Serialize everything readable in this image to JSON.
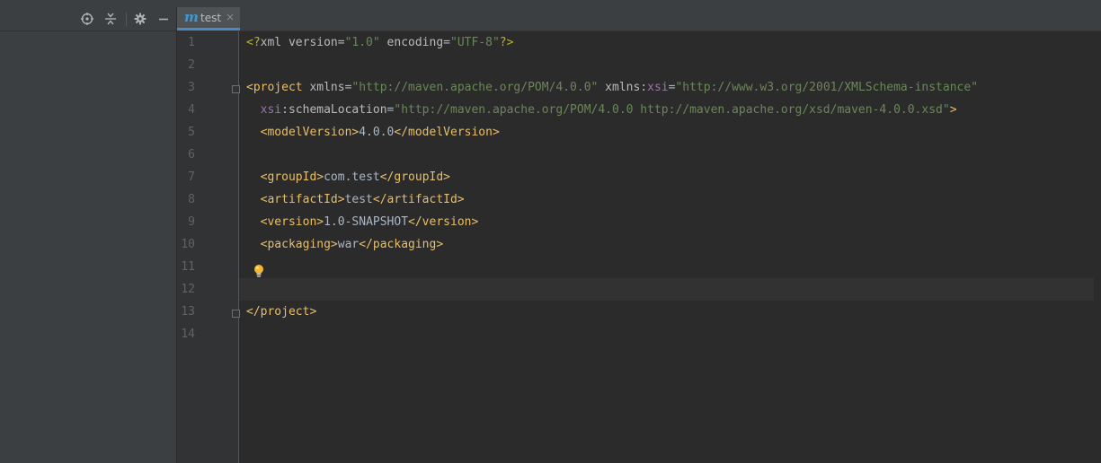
{
  "sidebar": {
    "buttons": [
      {
        "name": "locate-icon",
        "label": "Scroll from Source"
      },
      {
        "name": "collapse-all-icon",
        "label": "Collapse All"
      },
      {
        "name": "gear-icon",
        "label": "Settings"
      },
      {
        "name": "hide-icon",
        "label": "Hide"
      }
    ]
  },
  "editor": {
    "tab": {
      "icon": "maven-m-icon",
      "icon_text": "m",
      "label": "test",
      "close": "×",
      "active": true
    },
    "line_numbers": [
      "1",
      "2",
      "3",
      "4",
      "5",
      "6",
      "7",
      "8",
      "9",
      "10",
      "11",
      "12",
      "13",
      "14"
    ],
    "caret_line": 12,
    "lines": [
      [
        {
          "t": "pi",
          "v": "<?"
        },
        {
          "t": "attr",
          "v": "xml version"
        },
        {
          "t": "text",
          "v": "="
        },
        {
          "t": "val",
          "v": "\"1.0\""
        },
        {
          "t": "attr",
          "v": " encoding"
        },
        {
          "t": "text",
          "v": "="
        },
        {
          "t": "val",
          "v": "\"UTF-8\""
        },
        {
          "t": "pi",
          "v": "?>"
        }
      ],
      [],
      [
        {
          "t": "tag",
          "v": "<project "
        },
        {
          "t": "attr",
          "v": "xmlns"
        },
        {
          "t": "text",
          "v": "="
        },
        {
          "t": "val",
          "v": "\"http://maven.apache.org/POM/4.0.0\""
        },
        {
          "t": "attr",
          "v": " xmlns"
        },
        {
          "t": "text",
          "v": ":"
        },
        {
          "t": "ns",
          "v": "xsi"
        },
        {
          "t": "text",
          "v": "="
        },
        {
          "t": "val",
          "v": "\"http://www.w3.org/2001/XMLSchema-instance\""
        }
      ],
      [
        {
          "t": "text",
          "v": "  "
        },
        {
          "t": "ns",
          "v": "xsi"
        },
        {
          "t": "attr",
          "v": ":schemaLocation"
        },
        {
          "t": "text",
          "v": "="
        },
        {
          "t": "val",
          "v": "\"http://maven.apache.org/POM/4.0.0 http://maven.apache.org/xsd/maven-4.0.0.xsd\""
        },
        {
          "t": "tag",
          "v": ">"
        }
      ],
      [
        {
          "t": "text",
          "v": "  "
        },
        {
          "t": "tag",
          "v": "<modelVersion>"
        },
        {
          "t": "text",
          "v": "4.0.0"
        },
        {
          "t": "tag",
          "v": "</modelVersion>"
        }
      ],
      [],
      [
        {
          "t": "text",
          "v": "  "
        },
        {
          "t": "tag",
          "v": "<groupId>"
        },
        {
          "t": "text",
          "v": "com.test"
        },
        {
          "t": "tag",
          "v": "</groupId>"
        }
      ],
      [
        {
          "t": "text",
          "v": "  "
        },
        {
          "t": "tag",
          "v": "<artifactId>"
        },
        {
          "t": "text",
          "v": "test"
        },
        {
          "t": "tag",
          "v": "</artifactId>"
        }
      ],
      [
        {
          "t": "text",
          "v": "  "
        },
        {
          "t": "tag",
          "v": "<version>"
        },
        {
          "t": "text",
          "v": "1.0-SNAPSHOT"
        },
        {
          "t": "tag",
          "v": "</version>"
        }
      ],
      [
        {
          "t": "text",
          "v": "  "
        },
        {
          "t": "tag",
          "v": "<packaging>"
        },
        {
          "t": "text",
          "v": "war"
        },
        {
          "t": "tag",
          "v": "</packaging>"
        }
      ],
      [],
      [],
      [
        {
          "t": "tag",
          "v": "</project>"
        }
      ],
      []
    ],
    "fold_markers": [
      3,
      13
    ],
    "intention_bulb_line": 11
  },
  "colors": {
    "tag": "#e8bf6a",
    "attr": "#bababa",
    "value": "#6a8759",
    "namespace": "#9876aa",
    "text": "#a9b7c6",
    "line_number": "#606366",
    "tab_underline": "#4a88c7",
    "maven_icon": "#3a9ad9"
  }
}
